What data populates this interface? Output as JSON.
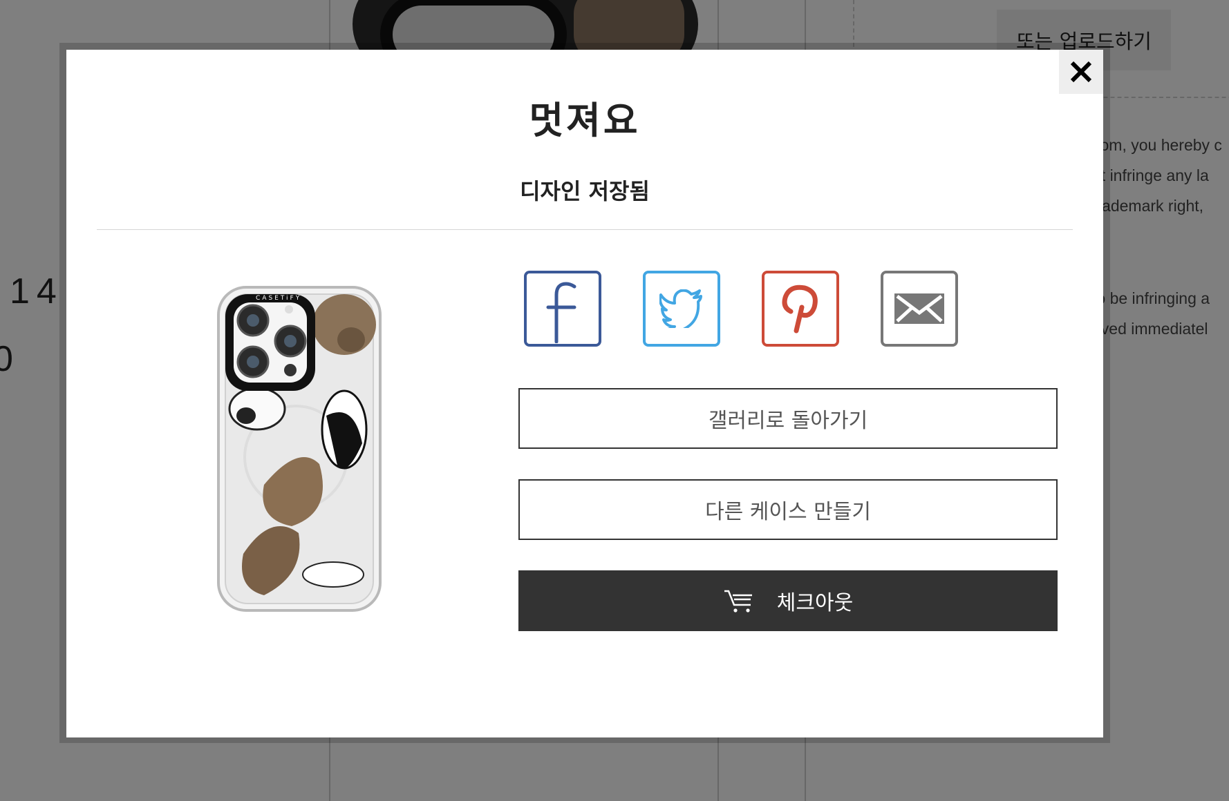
{
  "background": {
    "upload_label": "또는 업로드하기",
    "left_fragments": [
      "14",
      "0"
    ],
    "right_lines": [
      "com, you hereby c",
      "ot infringe any la",
      "trademark right,",
      "to be infringing a",
      "oved  immediatel"
    ]
  },
  "modal": {
    "title": "멋져요",
    "subtitle": "디자인 저장됨",
    "close_icon": "close-icon",
    "share": [
      {
        "name": "facebook",
        "icon": "facebook-icon",
        "color": "#3b5998"
      },
      {
        "name": "twitter",
        "icon": "twitter-icon",
        "color": "#42a6e3"
      },
      {
        "name": "pinterest",
        "icon": "pinterest-icon",
        "color": "#cd4b38"
      },
      {
        "name": "email",
        "icon": "mail-icon",
        "color": "#777777"
      }
    ],
    "buttons": {
      "gallery": "갤러리로 돌아가기",
      "another": "다른 케이스 만들기",
      "checkout": "체크아웃"
    },
    "case_brand": "CASETiFY"
  },
  "colors": {
    "checkout_bg": "#333333",
    "overlay": "rgba(0,0,0,0.5)"
  }
}
